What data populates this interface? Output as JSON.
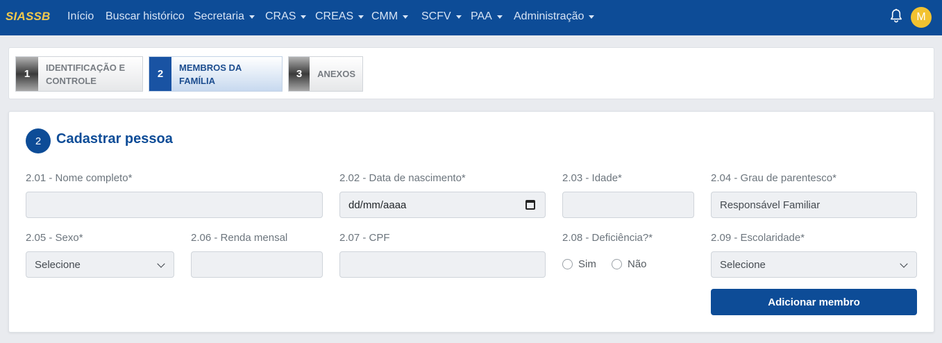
{
  "navbar": {
    "brand": "SIASSB",
    "items": [
      {
        "label": "Início",
        "dropdown": false
      },
      {
        "label": "Buscar histórico",
        "dropdown": false
      },
      {
        "label": "Secretaria",
        "dropdown": true
      },
      {
        "label": "CRAS",
        "dropdown": true
      },
      {
        "label": "CREAS",
        "dropdown": true
      },
      {
        "label": "CMM",
        "dropdown": true
      },
      {
        "label": "SCFV",
        "dropdown": true
      },
      {
        "label": "PAA",
        "dropdown": true
      },
      {
        "label": "Administração",
        "dropdown": true
      }
    ],
    "notification_icon": "bell-icon",
    "avatar_initial": "M",
    "colors": {
      "background": "#0d4c97",
      "brand": "#f2c94c",
      "avatar": "#f2c230"
    }
  },
  "stepper": {
    "steps": [
      {
        "number": "1",
        "label": "IDENTIFICAÇÃO E\nCONTROLE",
        "active": false
      },
      {
        "number": "2",
        "label": "MEMBROS DA\nFAMÍLIA",
        "active": true
      },
      {
        "number": "3",
        "label": "ANEXOS",
        "active": false
      }
    ]
  },
  "form": {
    "section_number": "2",
    "section_title": "Cadastrar pessoa",
    "fields": {
      "nome": {
        "label": "2.01 - Nome completo*",
        "value": ""
      },
      "nascimento": {
        "label": "2.02 - Data de nascimento*",
        "value": "dd/mm/aaaa"
      },
      "idade": {
        "label": "2.03 - Idade*",
        "value": ""
      },
      "parentesco": {
        "label": "2.04 - Grau de parentesco*",
        "value": "Responsável Familiar"
      },
      "sexo": {
        "label": "2.05 - Sexo*",
        "value": "Selecione"
      },
      "renda": {
        "label": "2.06 - Renda mensal",
        "value": ""
      },
      "cpf": {
        "label": "2.07 - CPF",
        "value": ""
      },
      "deficiencia": {
        "label": "2.08 - Deficiência?*",
        "options": [
          "Sim",
          "Não"
        ]
      },
      "escolaridade": {
        "label": "2.09 - Escolaridade*",
        "value": "Selecione"
      }
    },
    "submit_label": "Adicionar membro"
  }
}
